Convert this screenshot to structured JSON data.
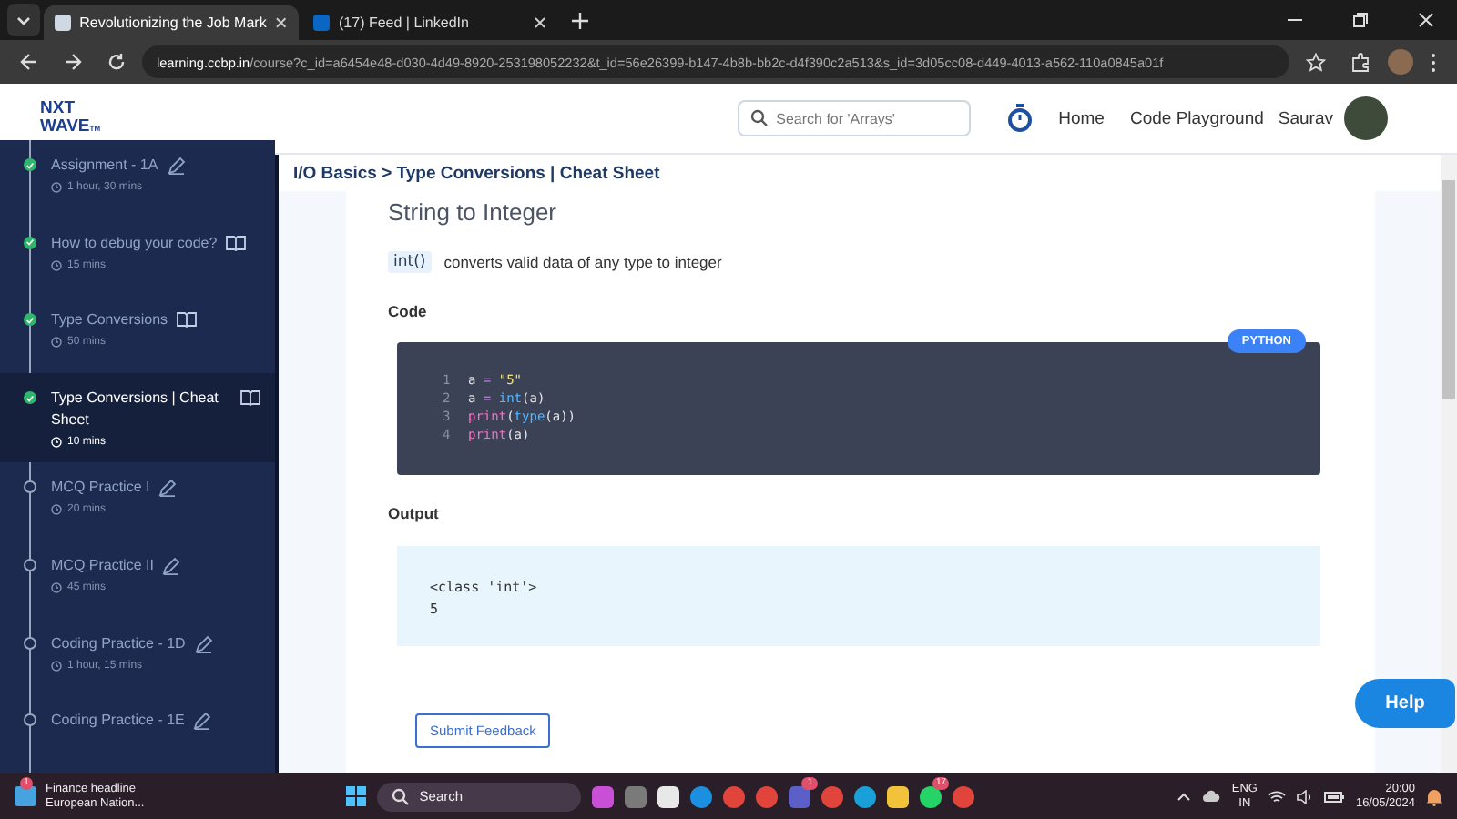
{
  "browser": {
    "tabs": [
      {
        "title": "Revolutionizing the Job Mark",
        "selected": true,
        "kind": "doc"
      },
      {
        "title": "(17) Feed | LinkedIn",
        "selected": false,
        "kind": "in"
      }
    ],
    "url_host": "learning.ccbp.in",
    "url_path": "/course?c_id=a6454e48-d030-4d49-8920-253198052232&t_id=56e26399-b147-4b8b-bb2c-d4f390c2a513&s_id=3d05cc08-d449-4013-a562-110a0845a01f"
  },
  "header": {
    "logo_top": "NXT",
    "logo_bottom": "WAVE",
    "logo_tm": "TM",
    "search": {
      "placeholder": "Search for 'Arrays'"
    },
    "nav": [
      "Home",
      "Code Playground"
    ],
    "user": "Saurav"
  },
  "sidebar": {
    "items": [
      {
        "title": "Assignment - 1A",
        "duration": "1 hour, 30 mins",
        "kind": "edit",
        "completed": true,
        "selected": false
      },
      {
        "title": "How to debug your code?",
        "duration": "15 mins",
        "kind": "read",
        "completed": true,
        "selected": false
      },
      {
        "title": "Type Conversions",
        "duration": "50 mins",
        "kind": "read",
        "completed": true,
        "selected": false
      },
      {
        "title": "Type Conversions | Cheat Sheet",
        "duration": "10 mins",
        "kind": "read",
        "completed": true,
        "selected": true
      },
      {
        "title": "MCQ Practice I",
        "duration": "20 mins",
        "kind": "edit",
        "completed": false,
        "selected": false
      },
      {
        "title": "MCQ Practice II",
        "duration": "45 mins",
        "kind": "edit",
        "completed": false,
        "selected": false
      },
      {
        "title": "Coding Practice - 1D",
        "duration": "1 hour, 15 mins",
        "kind": "edit",
        "completed": false,
        "selected": false
      },
      {
        "title": "Coding Practice - 1E",
        "kind": "edit",
        "completed": false,
        "selected": false
      }
    ]
  },
  "breadcrumb": "I/O Basics > Type Conversions | Cheat Sheet",
  "content": {
    "heading": "String to Integer",
    "inline_code": "int()",
    "description": "converts valid data of any type to integer",
    "code_label": "Code",
    "language": "PYTHON",
    "code_lines": [
      {
        "number": "1",
        "tokens": [
          {
            "text": "a",
            "kind": "plain"
          },
          {
            "text": " = ",
            "kind": "op"
          },
          {
            "text": "\"5\"",
            "kind": "str"
          }
        ]
      },
      {
        "number": "2",
        "tokens": [
          {
            "text": "a",
            "kind": "plain"
          },
          {
            "text": " = ",
            "kind": "op"
          },
          {
            "text": "int",
            "kind": "builtin"
          },
          {
            "text": "(a)",
            "kind": "plain"
          }
        ]
      },
      {
        "number": "3",
        "tokens": [
          {
            "text": "print",
            "kind": "func"
          },
          {
            "text": "(",
            "kind": "plain"
          },
          {
            "text": "type",
            "kind": "builtin"
          },
          {
            "text": "(a))",
            "kind": "plain"
          }
        ]
      },
      {
        "number": "4",
        "tokens": [
          {
            "text": "print",
            "kind": "func"
          },
          {
            "text": "(a)",
            "kind": "plain"
          }
        ]
      }
    ],
    "output_label": "Output",
    "output_lines": [
      "<class 'int'>",
      "5"
    ],
    "feedback_button": "Submit Feedback",
    "help_button": "Help"
  },
  "taskbar": {
    "widget_title": "Finance headline",
    "widget_text": "European Nation...",
    "widget_badge": "1",
    "search": "Search",
    "apps": [
      {
        "kind": "copilot"
      },
      {
        "kind": "windows"
      },
      {
        "kind": "store"
      },
      {
        "kind": "skype"
      },
      {
        "kind": "chrome"
      },
      {
        "kind": "chrome"
      },
      {
        "kind": "teams",
        "badge": "1"
      },
      {
        "kind": "chrome"
      },
      {
        "kind": "edge"
      },
      {
        "kind": "folder"
      },
      {
        "kind": "whatsapp",
        "badge": "17"
      },
      {
        "kind": "chrome"
      }
    ],
    "lang_top": "ENG",
    "lang_bottom": "IN",
    "time": "20:00",
    "date": "16/05/2024"
  }
}
